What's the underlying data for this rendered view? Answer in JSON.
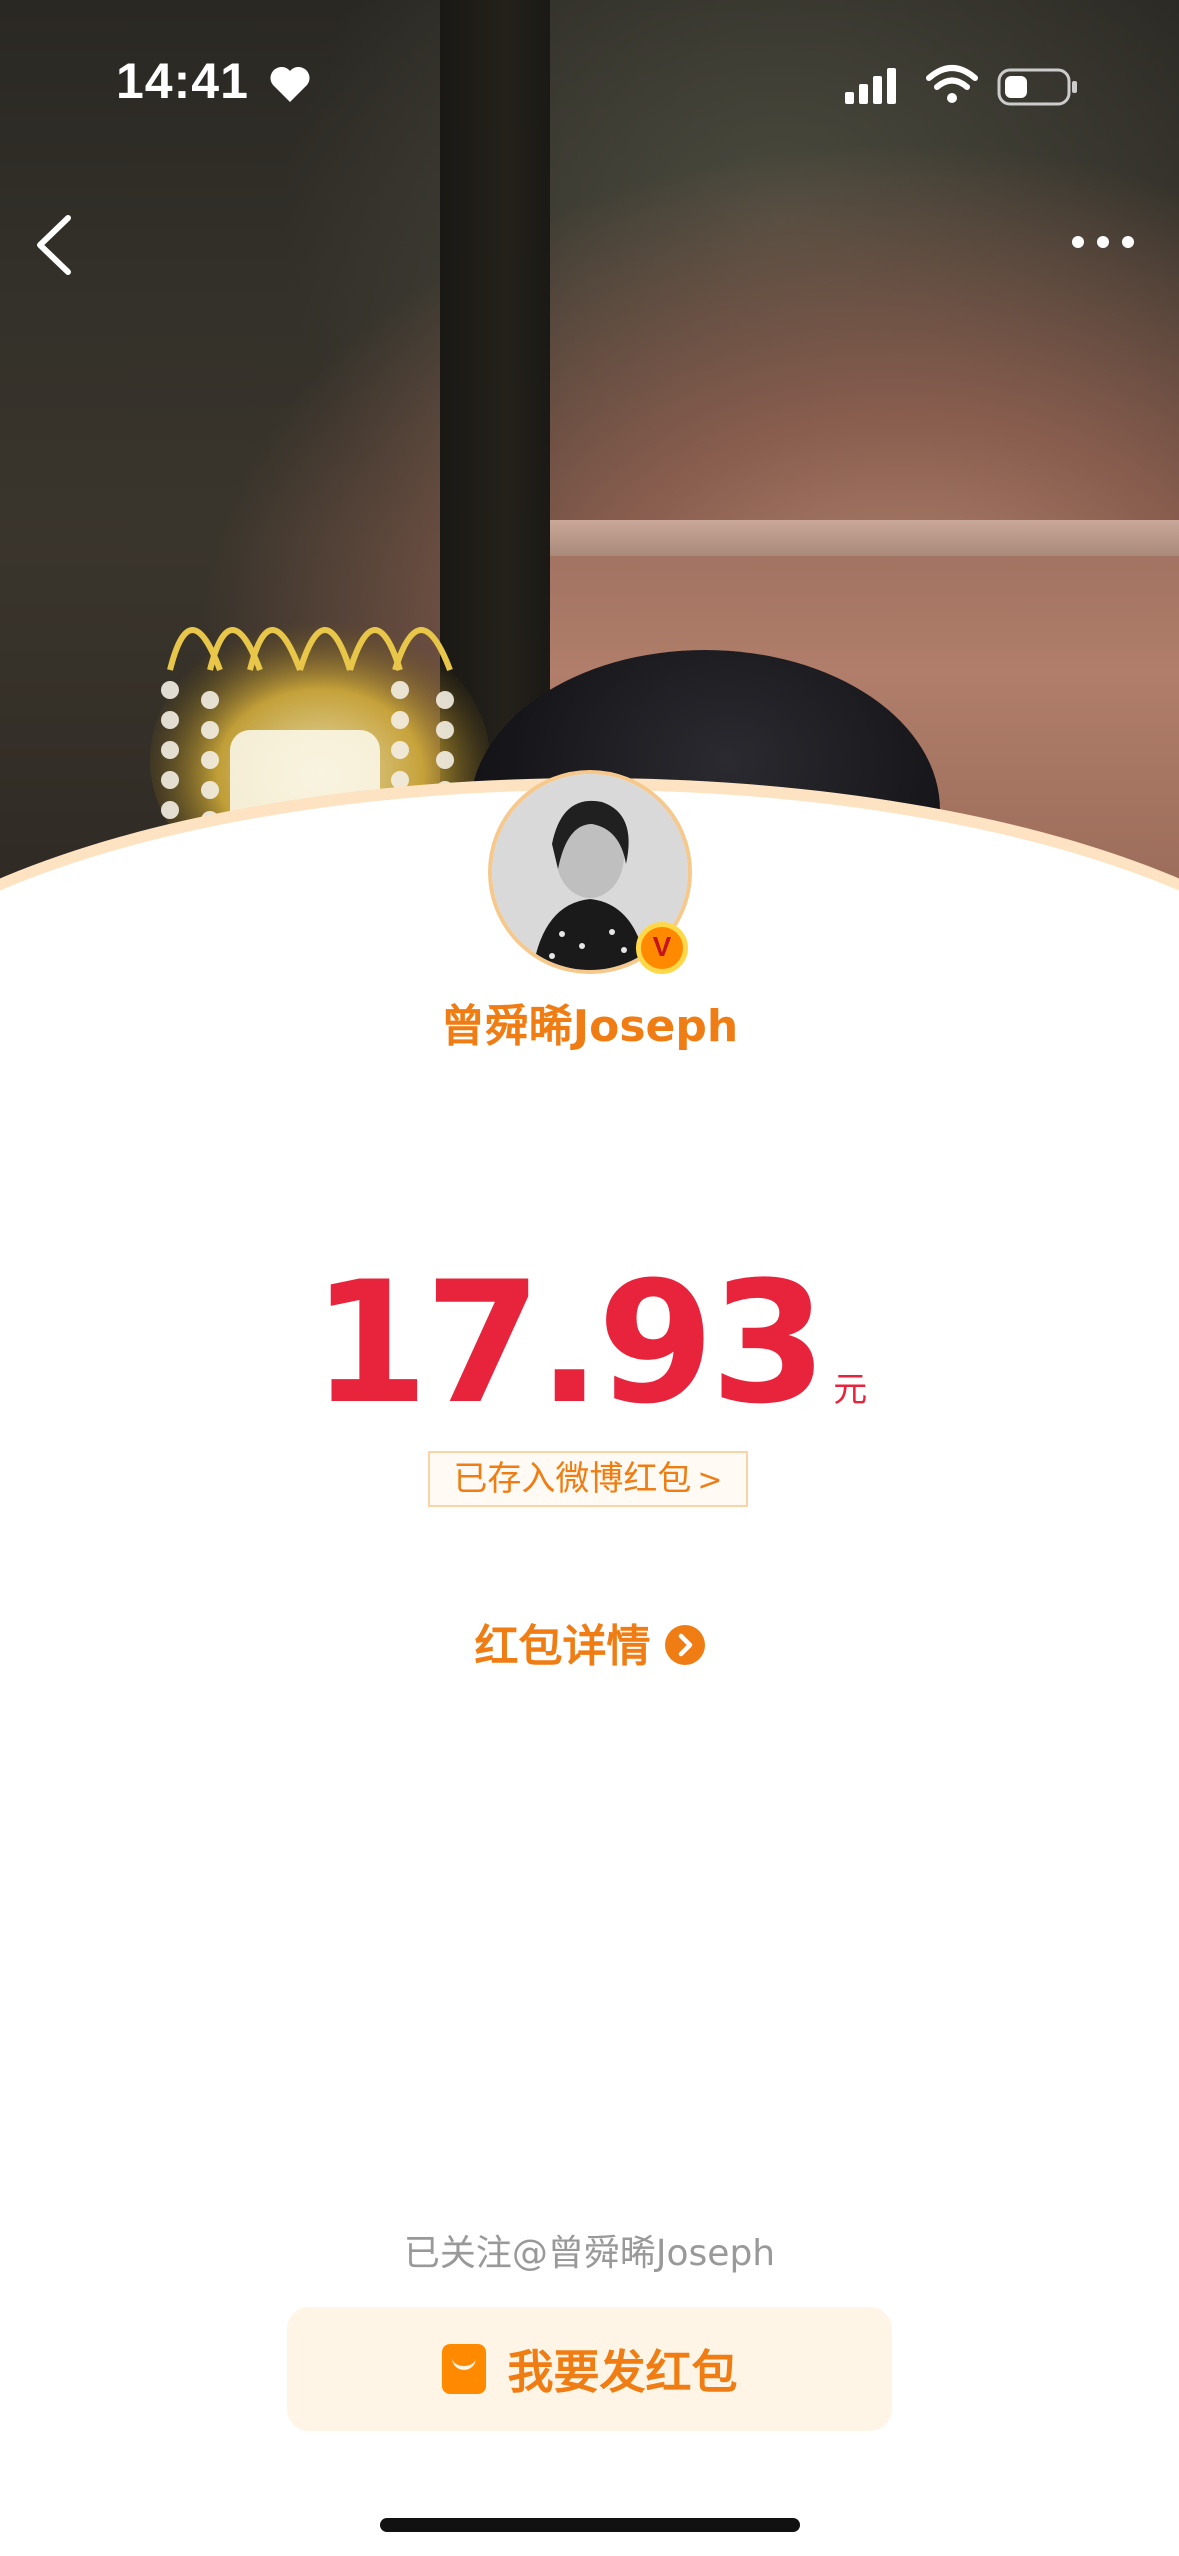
{
  "status_bar": {
    "time": "14:41"
  },
  "nav": {
    "back_icon": "chevron-left-icon",
    "more_icon": "ellipsis-icon"
  },
  "user": {
    "name": "曾舜晞Joseph",
    "verified_badge": "V"
  },
  "redpacket": {
    "amount": "17.93",
    "unit": "元",
    "saved_text": "已存入微博红包",
    "saved_chevron": ">",
    "detail_label": "红包详情"
  },
  "footer": {
    "followed_text": "已关注@曾舜晞Joseph",
    "send_button_label": "我要发红包"
  },
  "colors": {
    "accent_orange": "#f07d13",
    "amount_red": "#e8243c",
    "button_bg": "#fff5e6"
  }
}
